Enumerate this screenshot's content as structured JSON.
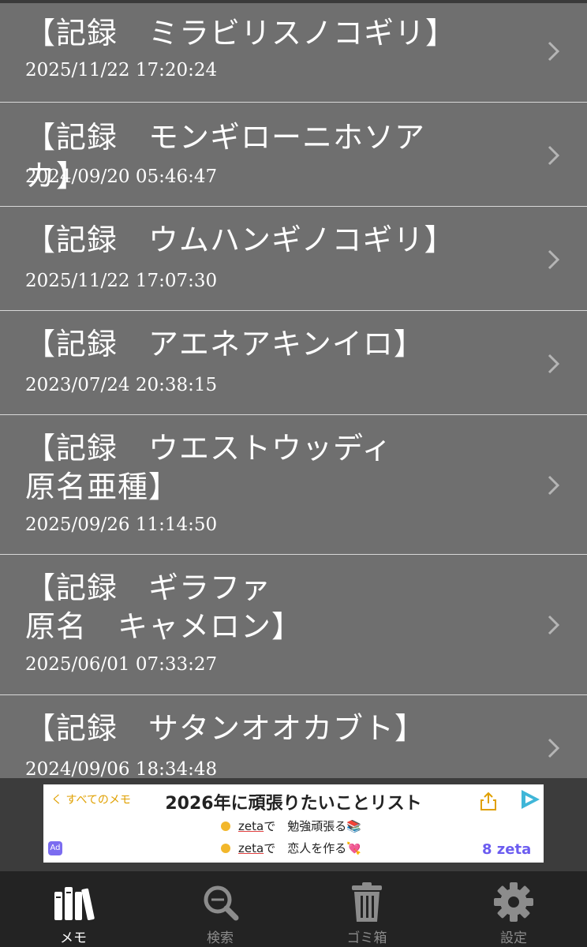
{
  "memos": [
    {
      "title": "【記録　ミラビリスノコギリ】",
      "date": "2025/11/22 17:20:24"
    },
    {
      "title": "【記録　モンギローニホソアカ】",
      "date": "2024/09/20 05:46:47"
    },
    {
      "title": "【記録　ウムハンギノコギリ】",
      "date": "2025/11/22 17:07:30"
    },
    {
      "title": "【記録　アエネアキンイロ】",
      "date": "2023/07/24 20:38:15"
    },
    {
      "title": "【記録　ウエストウッディ\n原名亜種】",
      "date": "2025/09/26 11:14:50"
    },
    {
      "title": "【記録　ギラファ\n原名　キャメロン】",
      "date": "2025/06/01 07:33:27"
    },
    {
      "title": "【記録　サタンオオカブト】",
      "date": "2024/09/06 18:34:48"
    }
  ],
  "ad": {
    "back_label": "く すべてのメモ",
    "title": "2026年に頑張りたいことリスト",
    "line1_brand": "zeta",
    "line1_text": "で　勉強頑張る📚",
    "line2_brand": "zeta",
    "line2_text": "で　恋人を作る💘",
    "logo_right": "8 zeta"
  },
  "tabs": [
    {
      "label": "メモ",
      "icon": "books-icon",
      "active": true
    },
    {
      "label": "検索",
      "icon": "search-icon",
      "active": false
    },
    {
      "label": "ゴミ箱",
      "icon": "trash-icon",
      "active": false
    },
    {
      "label": "設定",
      "icon": "gear-icon",
      "active": false
    }
  ],
  "colors": {
    "list_bg": "#6f6f6f",
    "divider": "#d8d8d8",
    "tabbar_bg": "#232323",
    "tab_active": "#ffffff",
    "tab_inactive": "#8c8c8c"
  }
}
